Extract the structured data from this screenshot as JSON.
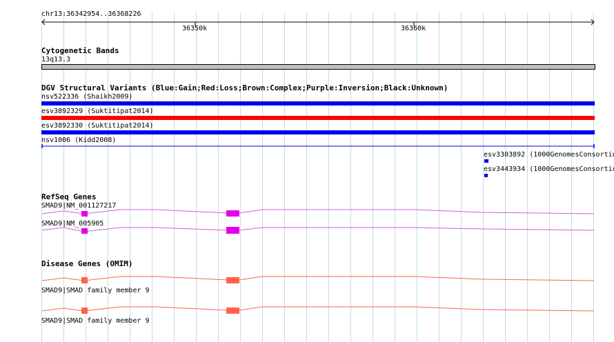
{
  "ruler": {
    "location": "chr13:36342954..36368226",
    "ticks": [
      "36350k",
      "36360k"
    ]
  },
  "cytogenetic": {
    "title": "Cytogenetic Bands",
    "band": "13q13.3"
  },
  "dgv": {
    "title": "DGV Structural Variants (Blue:Gain;Red:Loss;Brown:Complex;Purple:Inversion;Black:Unknown)",
    "variants": [
      {
        "label": "nsv522336 (Shaikh2009)",
        "type": "Gain"
      },
      {
        "label": "esv3892329 (Suktitipat2014)",
        "type": "Loss"
      },
      {
        "label": "esv3892330 (Suktitipat2014)",
        "type": "Gain"
      },
      {
        "label": "nsv1006 (Kidd2008)",
        "type": "Gain"
      },
      {
        "label": "esv3303892 (1000GenomesConsortium",
        "type": "Gain"
      },
      {
        "label": "esv3443934 (1000GenomesConsortium",
        "type": "Gain"
      }
    ]
  },
  "refseq": {
    "title": "RefSeq Genes",
    "genes": [
      {
        "label": "SMAD9|NM_001127217"
      },
      {
        "label": "SMAD9|NM_005905"
      }
    ]
  },
  "omim": {
    "title": "Disease Genes (OMIM)",
    "genes": [
      {
        "label": "SMAD9|SMAD family member 9"
      },
      {
        "label": "SMAD9|SMAD family member 9"
      }
    ]
  },
  "colors": {
    "gain": "#0000e6",
    "loss": "#ff0000",
    "refseq": "#e600e6",
    "refseq_line": "#d060d0",
    "omim": "#ff6347",
    "grid": "#b9dcef",
    "cyto_band": "#bfbfbf"
  }
}
